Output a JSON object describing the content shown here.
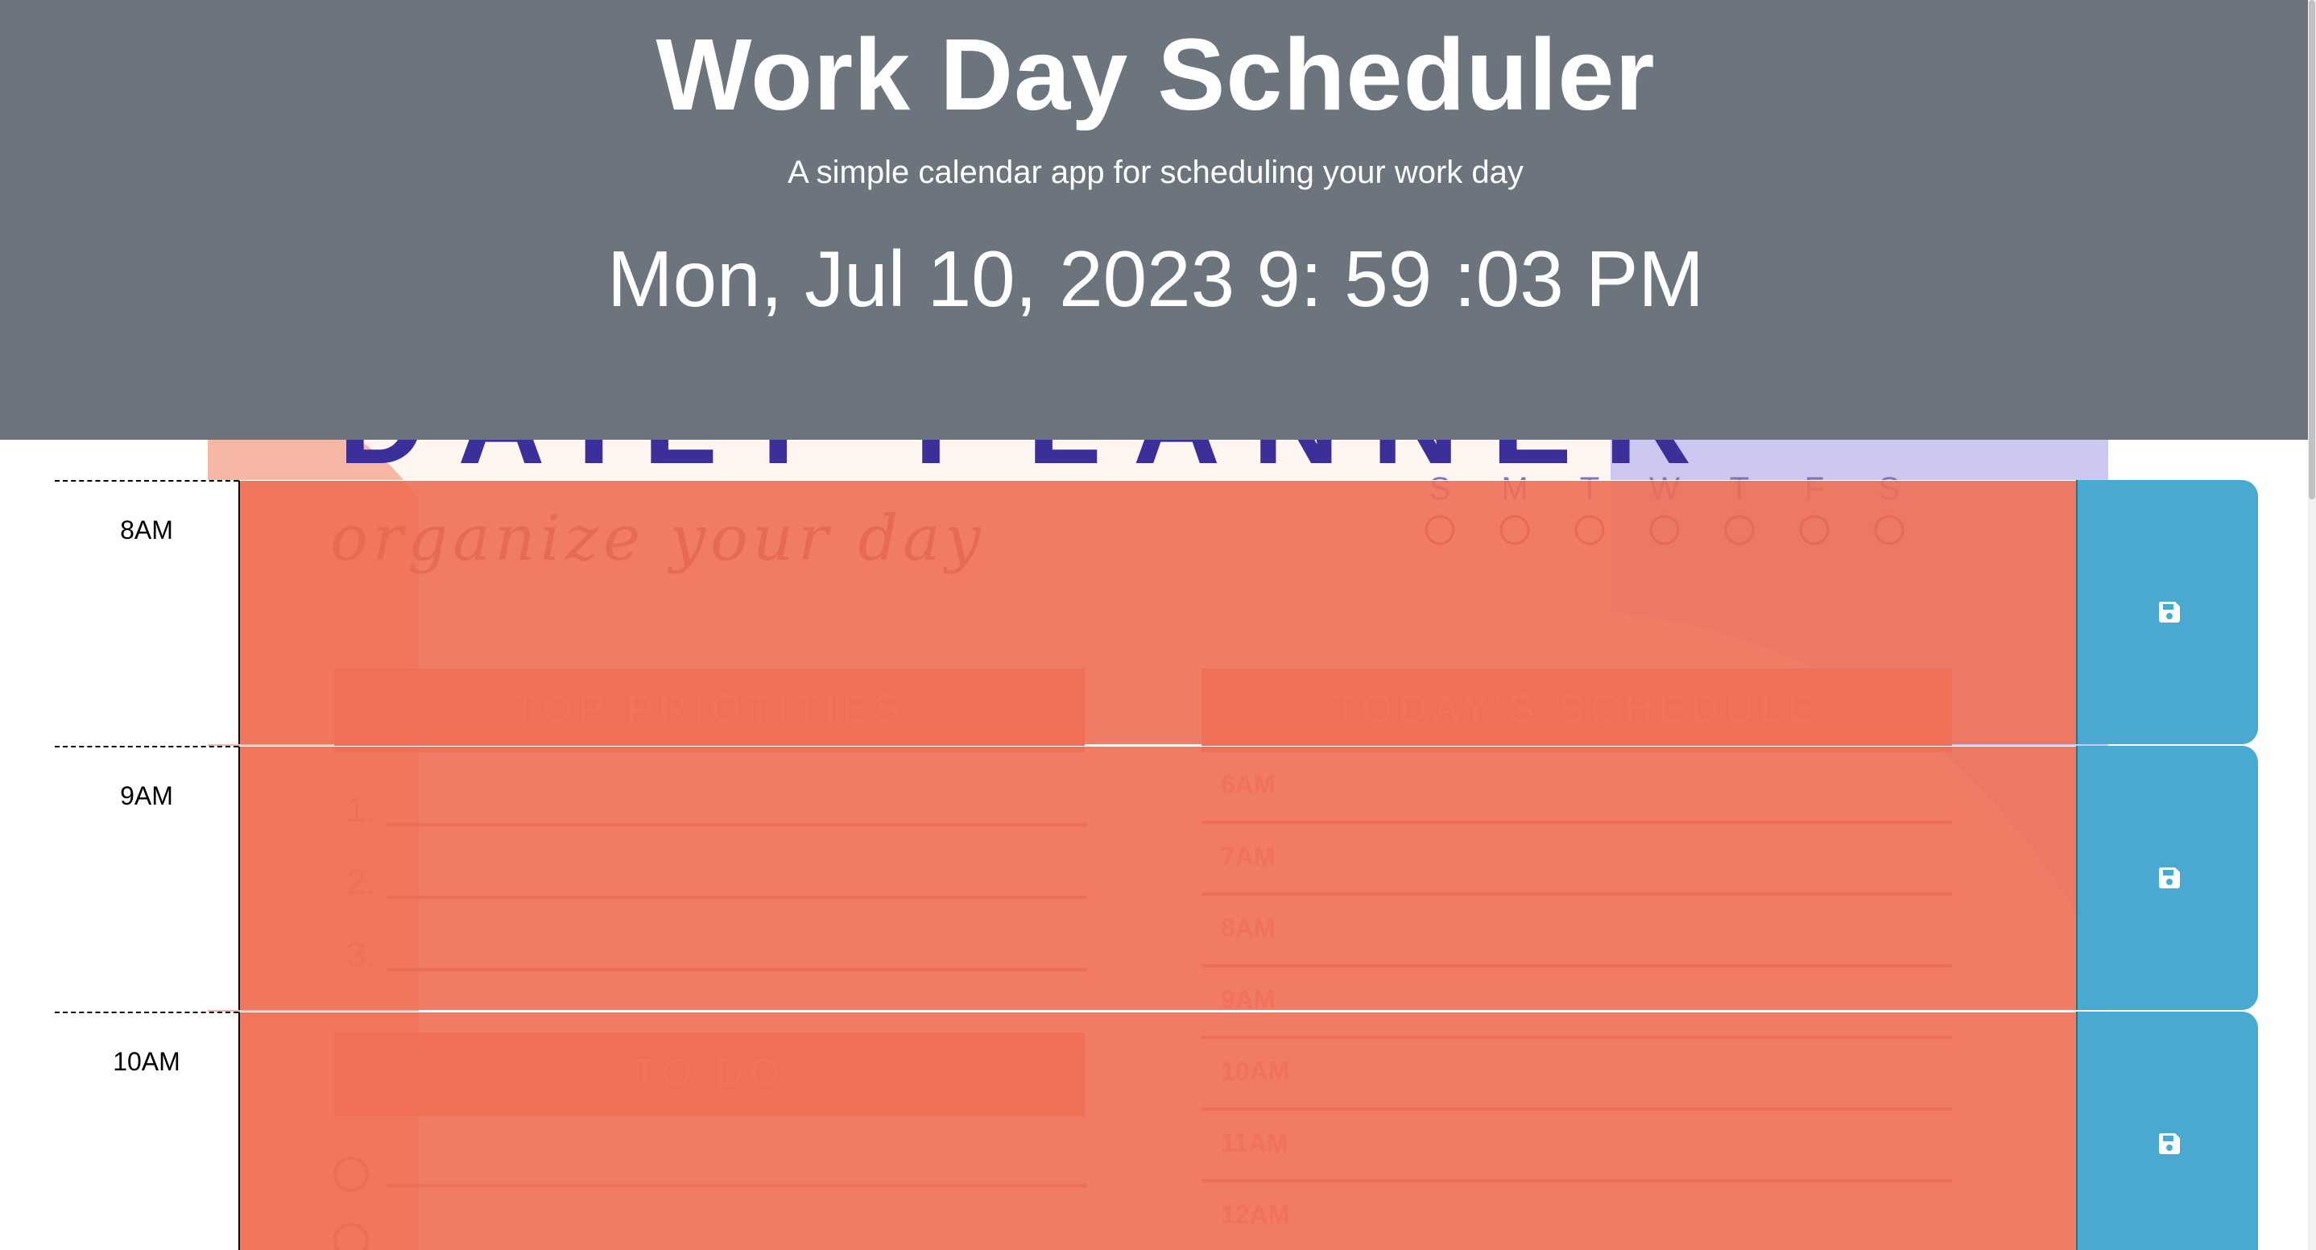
{
  "header": {
    "title": "Work Day Scheduler",
    "subtitle": "A simple calendar app for scheduling your work day",
    "current_datetime": "Mon, Jul 10, 2023 9: 59 :03 PM"
  },
  "colors": {
    "header_bg": "#6c757d",
    "past_block": "#f06f57",
    "save_button": "#4aa9d1"
  },
  "time_blocks": [
    {
      "hour": "8AM",
      "description": "",
      "state": "past",
      "save_icon": "floppy-disk-icon"
    },
    {
      "hour": "9AM",
      "description": "",
      "state": "past",
      "save_icon": "floppy-disk-icon"
    },
    {
      "hour": "10AM",
      "description": "",
      "state": "past",
      "save_icon": "floppy-disk-icon"
    }
  ],
  "background_art": {
    "heading": "DAILY PLANNER",
    "script": "organize your day",
    "weekdays": [
      "S",
      "M",
      "T",
      "W",
      "T",
      "F",
      "S"
    ],
    "panels": [
      "TOP PRIOTITIES",
      "TODAY'S SCHEDULE",
      "TO DO"
    ],
    "priority_numbers": [
      "1.",
      "2.",
      "3."
    ],
    "schedule_hours": [
      "6AM",
      "7AM",
      "8AM",
      "9AM",
      "10AM",
      "11AM",
      "12AM"
    ]
  }
}
